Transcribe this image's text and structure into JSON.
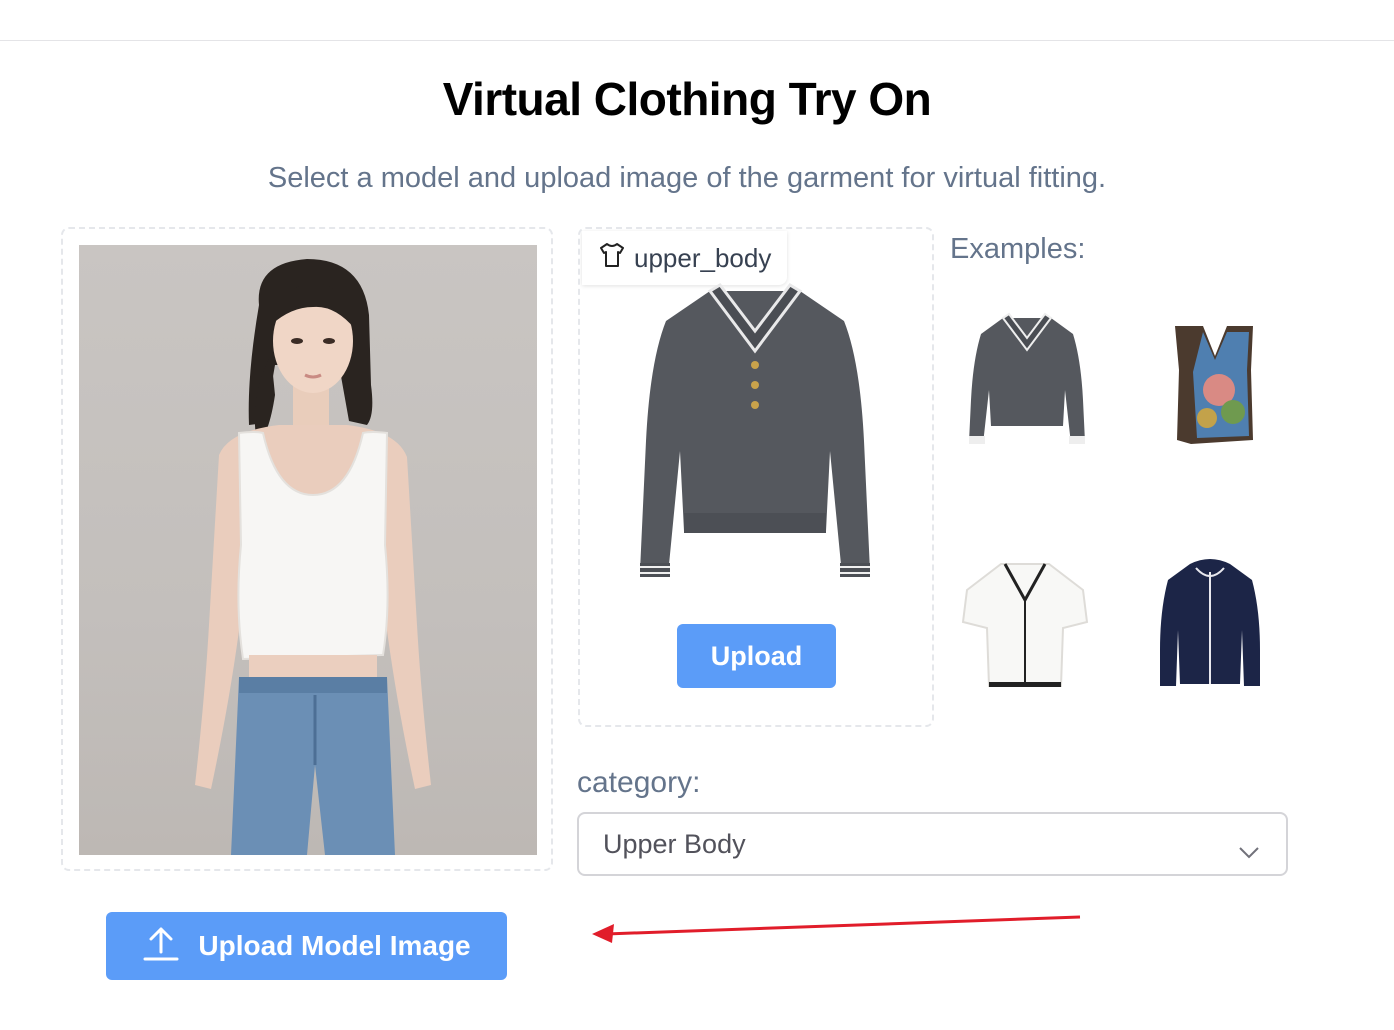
{
  "page": {
    "title": "Virtual Clothing Try On",
    "subtitle": "Select a model and upload image of the garment for virtual fitting."
  },
  "garment": {
    "tag_label": "upper_body",
    "upload_label": "Upload"
  },
  "examples": {
    "label": "Examples:",
    "items": [
      "gray-polo-sweater-thumb",
      "floral-sweater-vest-thumb",
      "white-blouse-thumb",
      "navy-hooded-jacket-thumb"
    ]
  },
  "category": {
    "label": "category:",
    "selected": "Upper Body"
  },
  "model_upload": {
    "label": "Upload Model Image"
  },
  "colors": {
    "accent": "#5b9cf8",
    "annotation_arrow": "#e11d2a",
    "muted_text": "#64748b"
  },
  "icons": [
    "tshirt-icon",
    "upload-icon",
    "chevron-down-icon"
  ]
}
